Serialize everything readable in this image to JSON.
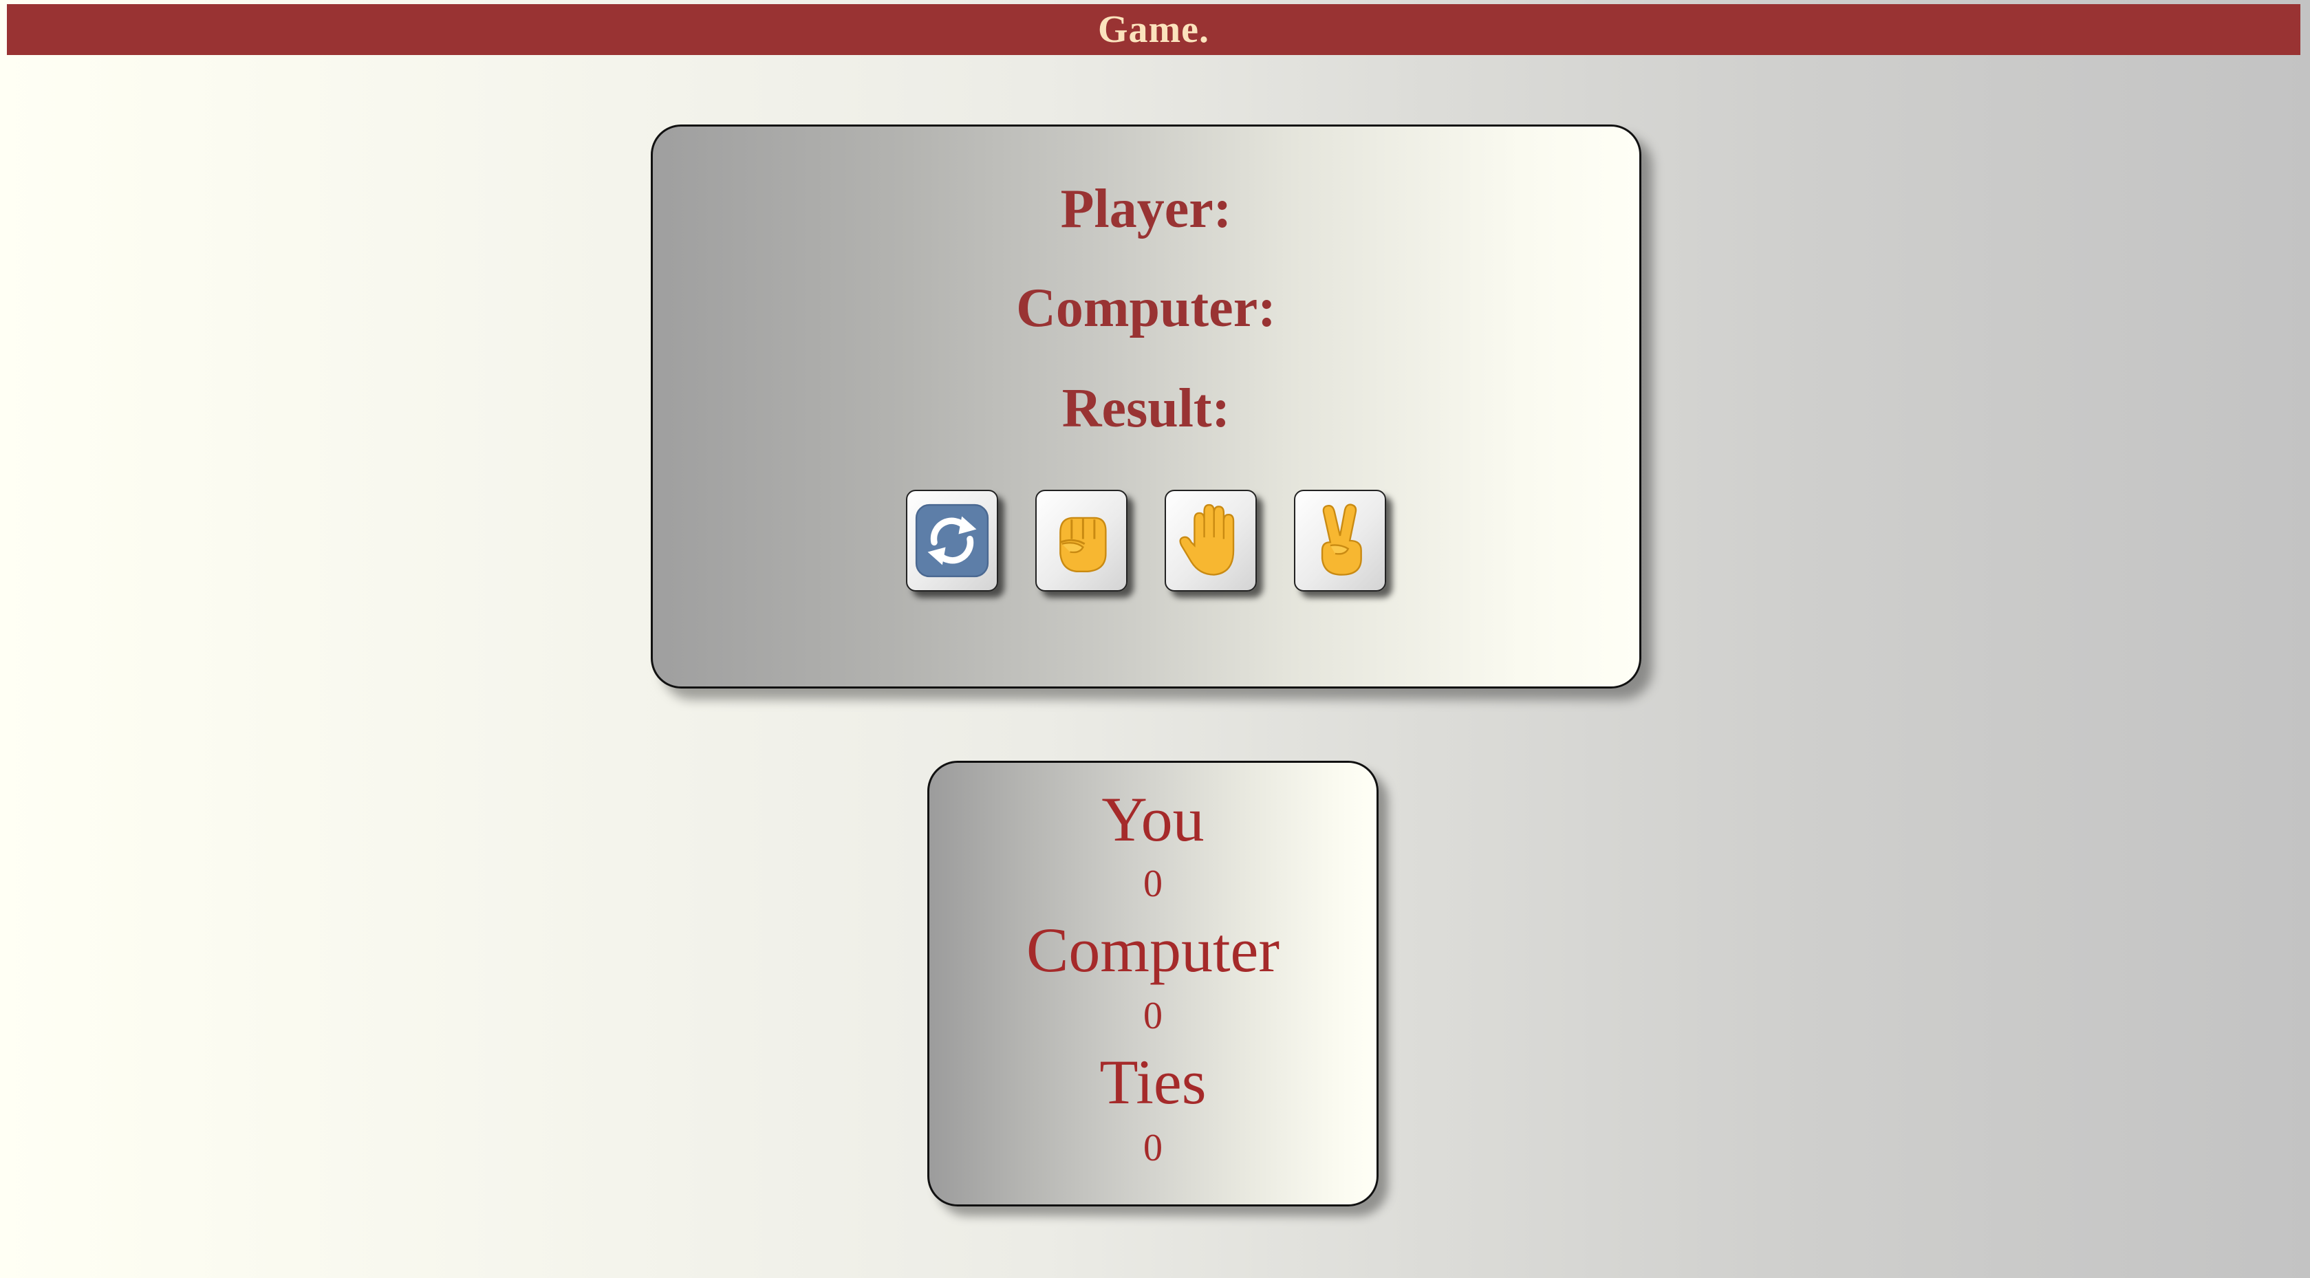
{
  "header": {
    "title": "Game."
  },
  "game": {
    "player_label": "Player:",
    "computer_label": "Computer:",
    "result_label": "Result:",
    "buttons": [
      {
        "name": "reset",
        "icon": "repeat-arrows-icon"
      },
      {
        "name": "rock",
        "icon": "raised-fist-icon"
      },
      {
        "name": "paper",
        "icon": "raised-hand-icon"
      },
      {
        "name": "scissors",
        "icon": "victory-hand-icon"
      }
    ]
  },
  "score": {
    "you_label": "You",
    "you_value": "0",
    "computer_label": "Computer",
    "computer_value": "0",
    "ties_label": "Ties",
    "ties_value": "0"
  },
  "colors": {
    "accent": "#993333",
    "header_text": "#fbe3bd",
    "score_text": "#a52a2a"
  }
}
